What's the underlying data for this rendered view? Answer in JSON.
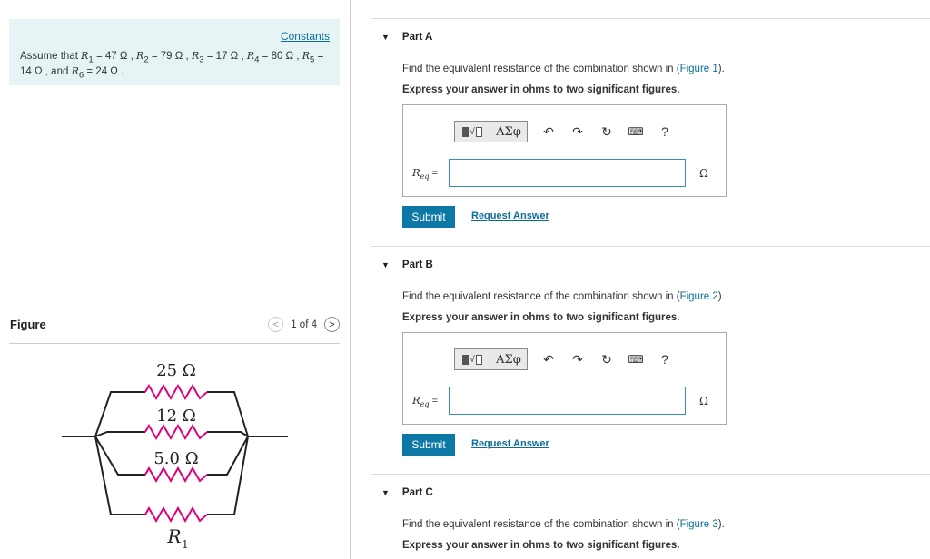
{
  "left": {
    "constants_link": "Constants",
    "problem": {
      "intro": "Assume that ",
      "values": [
        {
          "sym": "R",
          "sub": "1",
          "val": " = 47 Ω , "
        },
        {
          "sym": "R",
          "sub": "2",
          "val": " = 79 Ω , "
        },
        {
          "sym": "R",
          "sub": "3",
          "val": " = 17 Ω , "
        },
        {
          "sym": "R",
          "sub": "4",
          "val": " = 80 Ω , "
        },
        {
          "sym": "R",
          "sub": "5",
          "val": " = 14 Ω , and "
        },
        {
          "sym": "R",
          "sub": "6",
          "val": " = 24 Ω ."
        }
      ]
    },
    "figure": {
      "title": "Figure",
      "pager_text": "1 of 4",
      "labels": {
        "r_top": "25 Ω",
        "r_second": "12 Ω",
        "r_third": "5.0 Ω",
        "r_bottom_sym": "R",
        "r_bottom_sub": "1"
      },
      "resistor_color": "#e0007a"
    }
  },
  "parts": [
    {
      "title": "Part A",
      "question_pre": "Find the equivalent resistance of the combination shown in (",
      "figure_link": "Figure 1",
      "question_post": ").",
      "instruction": "Express your answer in ohms to two significant figures.",
      "field_label_sym": "R",
      "field_label_sub": "eq",
      "field_label_eq": " =",
      "field_value": "",
      "unit": "Ω",
      "submit": "Submit",
      "request": "Request Answer"
    },
    {
      "title": "Part B",
      "question_pre": "Find the equivalent resistance of the combination shown in (",
      "figure_link": "Figure 2",
      "question_post": ").",
      "instruction": "Express your answer in ohms to two significant figures.",
      "field_label_sym": "R",
      "field_label_sub": "eq",
      "field_label_eq": " =",
      "field_value": "",
      "unit": "Ω",
      "submit": "Submit",
      "request": "Request Answer"
    },
    {
      "title": "Part C",
      "question_pre": "Find the equivalent resistance of the combination shown in (",
      "figure_link": "Figure 3",
      "question_post": ").",
      "instruction": "Express your answer in ohms to two significant figures."
    }
  ],
  "toolbar": {
    "templates_icon": "templates-icon",
    "symbols_label": "ΑΣφ",
    "undo_icon": "↶",
    "redo_icon": "↷",
    "reset_icon": "↻",
    "keyboard_icon": "⌨",
    "help_icon": "?"
  },
  "colors": {
    "accent": "#0d78a6",
    "link": "#0b6e99",
    "given_bg": "#e7f4f5"
  }
}
